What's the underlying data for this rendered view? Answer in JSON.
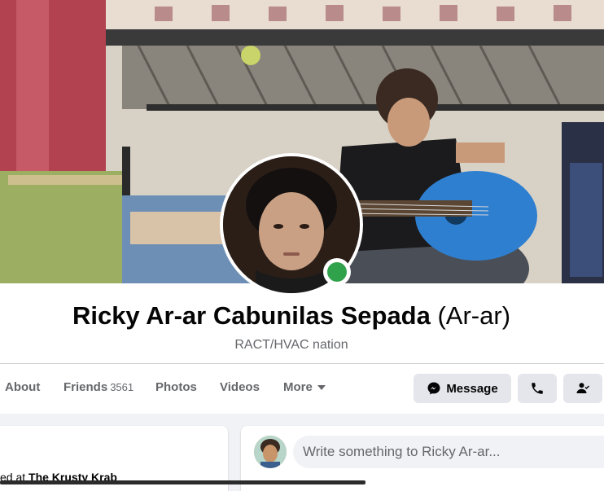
{
  "profile": {
    "name": "Ricky Ar-ar Cabunilas Sepada",
    "alt_name": "(Ar-ar)",
    "bio": "RACT/HVAC nation",
    "online": true
  },
  "tabs": [
    {
      "label": "About"
    },
    {
      "label": "Friends",
      "count": "3561"
    },
    {
      "label": "Photos"
    },
    {
      "label": "Videos"
    },
    {
      "label": "More"
    }
  ],
  "actions": {
    "message_label": "Message",
    "call_icon": "phone-icon",
    "friend_icon": "friend-check-icon"
  },
  "intro": {
    "text_prefix": "ed at ",
    "workplace": "The Krusty Krab"
  },
  "composer": {
    "placeholder": "Write something to Ricky Ar-ar..."
  },
  "colors": {
    "accent_online": "#31a24c",
    "button_bg": "#e4e6eb",
    "muted_text": "#65676b"
  }
}
